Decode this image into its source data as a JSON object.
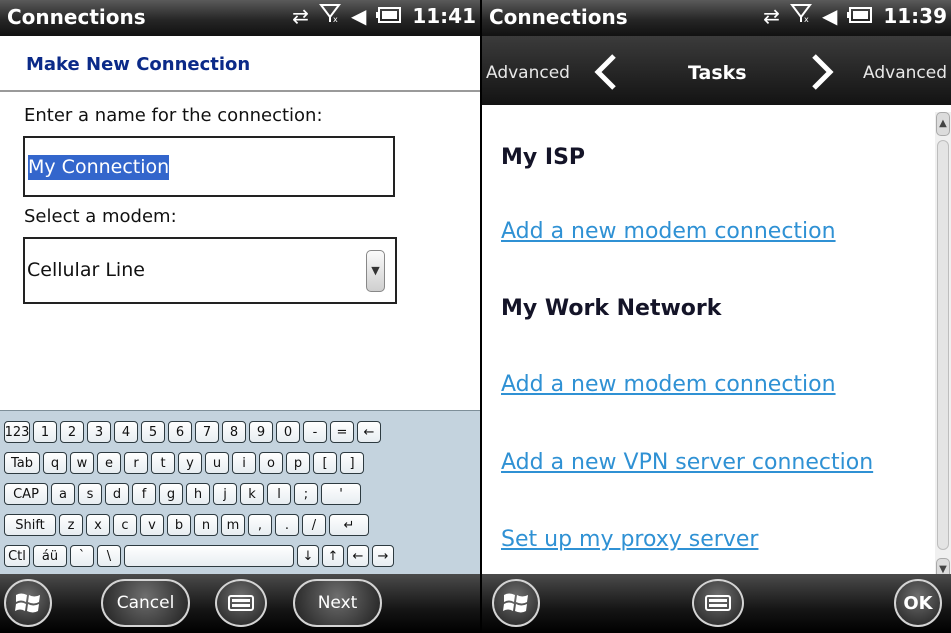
{
  "left": {
    "status": {
      "title": "Connections",
      "time": "11:41"
    },
    "header": "Make New Connection",
    "name_label": "Enter a name for the connection:",
    "name_value": "My Connection",
    "modem_label": "Select a modem:",
    "modem_value": "Cellular Line",
    "keyboard": {
      "row1": [
        "123",
        "1",
        "2",
        "3",
        "4",
        "5",
        "6",
        "7",
        "8",
        "9",
        "0",
        "-",
        "=",
        "←"
      ],
      "row2": [
        "Tab",
        "q",
        "w",
        "e",
        "r",
        "t",
        "y",
        "u",
        "i",
        "o",
        "p",
        "[",
        "]"
      ],
      "row3": [
        "CAP",
        "a",
        "s",
        "d",
        "f",
        "g",
        "h",
        "j",
        "k",
        "l",
        ";",
        "'"
      ],
      "row4": [
        "Shift",
        "z",
        "x",
        "c",
        "v",
        "b",
        "n",
        "m",
        ",",
        ".",
        "/",
        "↵"
      ],
      "row5": [
        "Ctl",
        "áü",
        "`",
        "\\",
        "",
        "↓",
        "↑",
        "←",
        "→"
      ]
    },
    "bottom": {
      "cancel": "Cancel",
      "next": "Next"
    }
  },
  "right": {
    "status": {
      "title": "Connections",
      "time": "11:39"
    },
    "tasks_bar": {
      "left": "Advanced",
      "center": "Tasks",
      "right": "Advanced"
    },
    "sections": [
      {
        "heading": "My ISP",
        "links": [
          "Add a new modem connection"
        ]
      },
      {
        "heading": "My Work Network",
        "links": [
          "Add a new modem connection",
          "Add a new VPN server connection",
          "Set up my proxy server"
        ]
      }
    ],
    "bottom": {
      "ok": "OK"
    }
  }
}
